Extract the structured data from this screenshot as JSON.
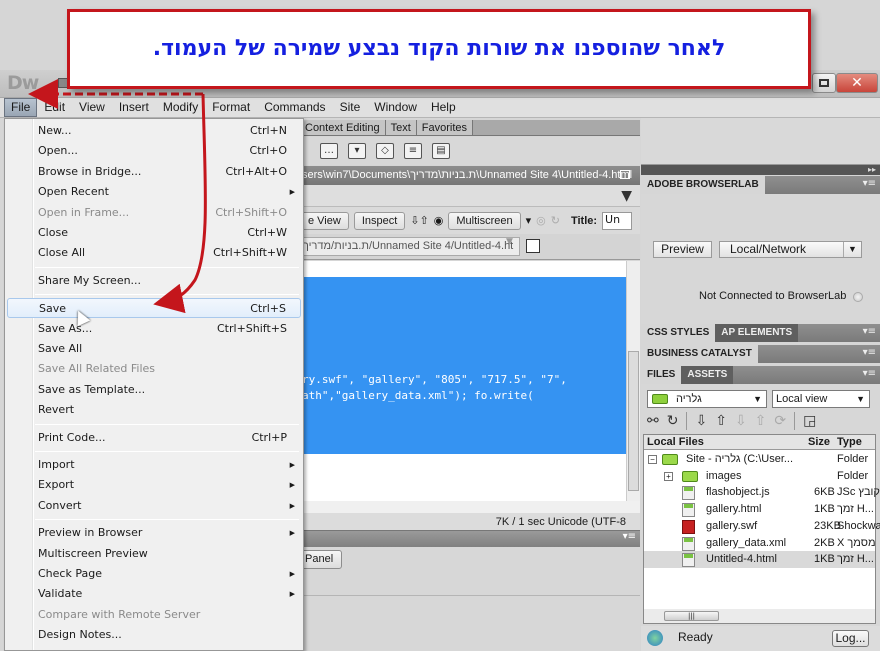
{
  "annotation": {
    "callout_text": "לאחר שהוספנו את שורות הקוד נבצע שמירה של העמוד.",
    "colors": {
      "border": "#c4161c",
      "text": "#1520e0",
      "arrow": "#c4161c"
    }
  },
  "app": {
    "logo": "Dw",
    "close_glyph": "✕"
  },
  "menubar": [
    "File",
    "Edit",
    "View",
    "Insert",
    "Modify",
    "Format",
    "Commands",
    "Site",
    "Window",
    "Help"
  ],
  "insert_bar": {
    "tabs": [
      "Context Editing",
      "Text",
      "Favorites"
    ]
  },
  "document": {
    "title_path": "sers\\win7\\Documents\\ת.בניות\\מדריך\\Unnamed Site 4\\Untitled-4.html",
    "toolbar": {
      "live_view": "e View",
      "inspect": "Inspect",
      "multiscreen": "Multiscreen",
      "title_label": "Title:",
      "title_value": "Un"
    },
    "address": "ת.בניות/מדריך/Unnamed Site 4/Untitled-4.ht",
    "code_lines": [
      "ry.swf\", \"gallery\", \"805\", \"717.5\", \"7\",",
      "ath\",\"gallery_data.xml\"); fo.write("
    ],
    "status": "7K / 1 sec  Unicode (UTF-8"
  },
  "properties": {
    "panel_button": "Panel"
  },
  "file_menu": {
    "items": [
      {
        "label": "New...",
        "shortcut": "Ctrl+N"
      },
      {
        "label": "Open...",
        "shortcut": "Ctrl+O"
      },
      {
        "label": "Browse in Bridge...",
        "shortcut": "Ctrl+Alt+O"
      },
      {
        "label": "Open Recent",
        "submenu": true
      },
      {
        "label": "Open in Frame...",
        "shortcut": "Ctrl+Shift+O",
        "disabled": true
      },
      {
        "label": "Close",
        "shortcut": "Ctrl+W"
      },
      {
        "label": "Close All",
        "shortcut": "Ctrl+Shift+W"
      },
      {
        "label": "Share My Screen..."
      },
      {
        "label": "Save",
        "shortcut": "Ctrl+S",
        "highlighted": true
      },
      {
        "label": "Save As...",
        "shortcut": "Ctrl+Shift+S"
      },
      {
        "label": "Save All"
      },
      {
        "label": "Save All Related Files",
        "disabled": true
      },
      {
        "label": "Save as Template..."
      },
      {
        "label": "Revert"
      },
      {
        "label": "Print Code...",
        "shortcut": "Ctrl+P"
      },
      {
        "label": "Import",
        "submenu": true
      },
      {
        "label": "Export",
        "submenu": true
      },
      {
        "label": "Convert",
        "submenu": true
      },
      {
        "label": "Preview in Browser",
        "submenu": true
      },
      {
        "label": "Multiscreen Preview"
      },
      {
        "label": "Check Page",
        "submenu": true
      },
      {
        "label": "Validate",
        "submenu": true
      },
      {
        "label": "Compare with Remote Server",
        "disabled": true
      },
      {
        "label": "Design Notes..."
      }
    ]
  },
  "right_panels": {
    "browserlab": {
      "title": "ADOBE BROWSERLAB",
      "preview_button": "Preview",
      "mode_select": "Local/Network",
      "status": "Not Connected to BrowserLab"
    },
    "css_tabs": [
      "CSS STYLES",
      "AP ELEMENTS"
    ],
    "business_catalyst": "BUSINESS CATALYST",
    "files_tabs": [
      "FILES",
      "ASSETS"
    ],
    "files": {
      "site_select": "גלריה",
      "view_select": "Local view",
      "columns": [
        "Local Files",
        "Size",
        "Type"
      ],
      "rows": [
        {
          "name": "Site - גלריה (C:\\User...",
          "size": "",
          "type": "Folder",
          "kind": "folder",
          "level": 0,
          "expander": "−"
        },
        {
          "name": "images",
          "size": "",
          "type": "Folder",
          "kind": "folder",
          "level": 1,
          "expander": "+"
        },
        {
          "name": "flashobject.js",
          "size": "6KB",
          "type": "JSc קובץ",
          "kind": "file",
          "level": 1
        },
        {
          "name": "gallery.html",
          "size": "1KB",
          "type": "זמך H...",
          "kind": "file",
          "level": 1
        },
        {
          "name": "gallery.swf",
          "size": "23KB",
          "type": "Shockwa",
          "kind": "swf",
          "level": 1
        },
        {
          "name": "gallery_data.xml",
          "size": "2KB",
          "type": "X מסמך",
          "kind": "file",
          "level": 1
        },
        {
          "name": "Untitled-4.html",
          "size": "1KB",
          "type": "זמך H...",
          "kind": "file",
          "level": 1,
          "selected": true
        }
      ],
      "status": "Ready",
      "log_button": "Log..."
    }
  }
}
